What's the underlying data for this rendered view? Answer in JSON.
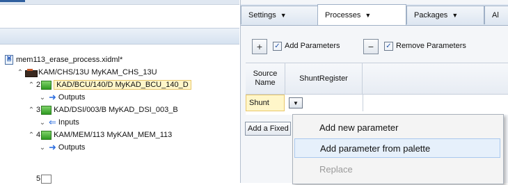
{
  "tree": {
    "root": {
      "label": "mem113_erase_process.xidml*"
    },
    "items": [
      {
        "prefix": "",
        "label": "KAM/CHS/13U  MyKAM_CHS_13U"
      },
      {
        "prefix": "2",
        "label": "KAD/BCU/140/D  MyKAD_BCU_140_D"
      },
      {
        "prefix": "",
        "label": "Outputs"
      },
      {
        "prefix": "3",
        "label": "KAD/DSI/003/B  MyKAD_DSI_003_B"
      },
      {
        "prefix": "",
        "label": "Inputs"
      },
      {
        "prefix": "4",
        "label": "KAM/MEM/113  MyKAM_MEM_113"
      },
      {
        "prefix": "",
        "label": "Outputs"
      },
      {
        "prefix": "5",
        "label": ""
      }
    ]
  },
  "tabs": [
    {
      "label": "Settings"
    },
    {
      "label": "Processes"
    },
    {
      "label": "Packages"
    },
    {
      "label": "Al"
    }
  ],
  "toolbar": {
    "add_button": "+",
    "add_params_label": "Add Parameters",
    "add_params_checked": "✓",
    "remove_button": "−",
    "remove_params_label": "Remove Parameters",
    "remove_params_checked": "✓"
  },
  "grid": {
    "headers": [
      "Source\nName",
      "ShuntRegister"
    ],
    "rows": [
      {
        "source": "Shunt",
        "dropdown": "▼"
      }
    ]
  },
  "add_fixed_button": "Add a Fixed",
  "context_menu": {
    "items": [
      {
        "label": "Add new parameter",
        "state": "normal"
      },
      {
        "label": "Add parameter from palette",
        "state": "hover"
      },
      {
        "label": "Replace",
        "state": "disabled"
      }
    ]
  },
  "icons": {
    "expand": "⌃",
    "collapse": "⌄",
    "arrow_right": "➜",
    "arrow_left": "⇐",
    "dropdown": "▼"
  }
}
